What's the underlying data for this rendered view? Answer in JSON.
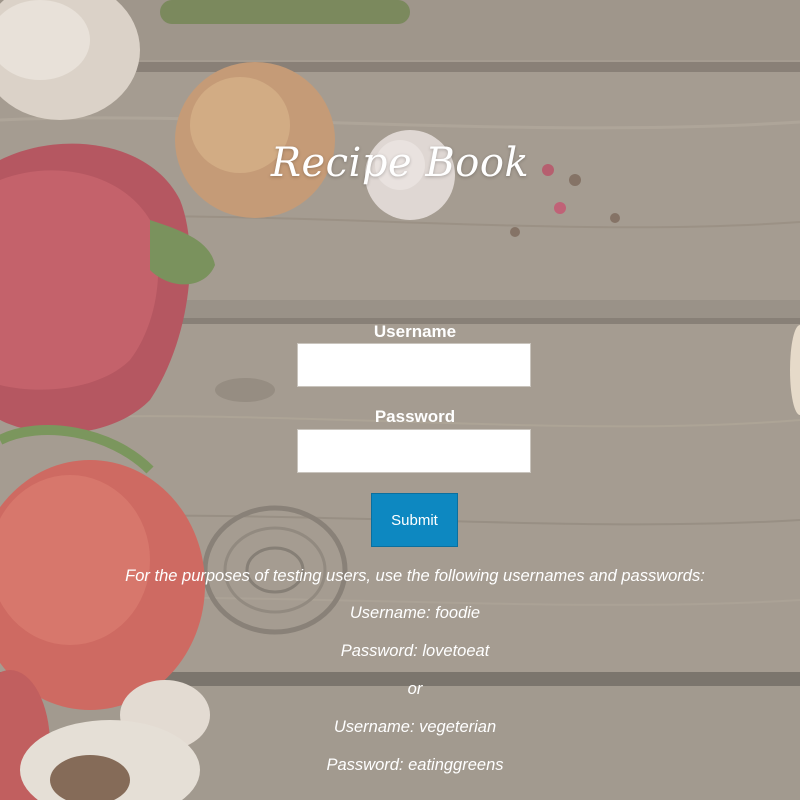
{
  "page": {
    "title": "Recipe Book"
  },
  "form": {
    "username_label": "Username",
    "password_label": "Password",
    "username_value": "",
    "password_value": "",
    "submit_label": "Submit"
  },
  "testing_note": {
    "intro": "For the purposes of testing users, use the following usernames and passwords:",
    "lines": [
      "Username: foodie",
      "Password: lovetoeat",
      "or",
      "Username: vegeterian",
      "Password: eatinggreens"
    ]
  },
  "colors": {
    "submit_button": "#0d88c1",
    "text": "#ffffff",
    "background_wood": "#8f8579"
  },
  "icons": {
    "background": "vegetables-on-wood-photo"
  }
}
